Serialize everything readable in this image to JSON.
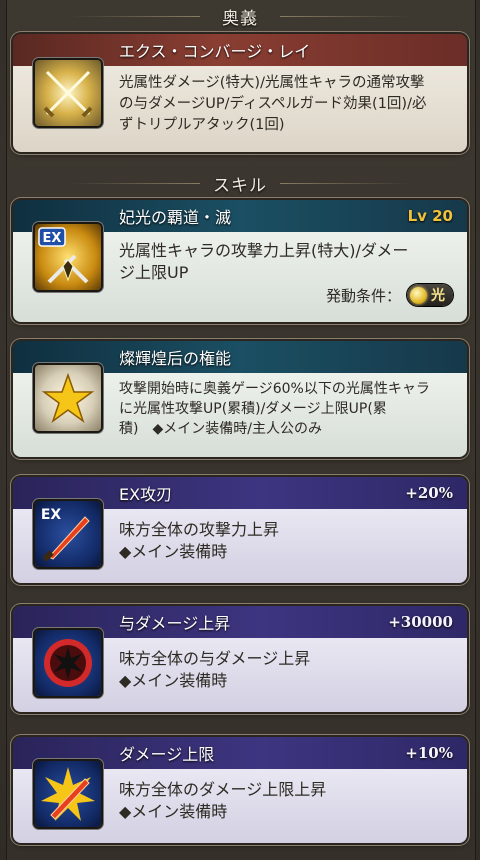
{
  "sections": {
    "ougi_title": "奥義",
    "skill_title": "スキル"
  },
  "ougi": {
    "name": "エクス・コンバージ・レイ",
    "desc_lines": [
      "光属性ダメージ(特大)/光属性キャラの通常攻撃",
      "の与ダメージUP/ディスペルガード効果(1回)/必",
      "ずトリプルアタック(1回)"
    ],
    "icon": "crossed-swords-icon"
  },
  "skills": [
    {
      "name": "妃光の覇道・滅",
      "level": "Lv 20",
      "desc_lines": [
        "光属性キャラの攻撃力上昇(特大)/ダメー",
        "ジ上限UP"
      ],
      "condition_label": "発動条件：",
      "condition_value": "光",
      "icon": "ex-swords-icon"
    },
    {
      "name": "燦輝煌后の権能",
      "desc_lines": [
        "攻撃開始時に奥義ゲージ60%以下の光属性キャラ",
        "に光属性攻撃UP(累積)/ダメージ上限UP(累",
        "積)　◆メイン装備時/主人公のみ"
      ],
      "icon": "star-icon"
    }
  ],
  "supports": [
    {
      "name": "EX攻刃",
      "value": "+20%",
      "desc_lines": [
        "味方全体の攻撃力上昇",
        "◆メイン装備時"
      ],
      "icon": "ex-blade-icon"
    },
    {
      "name": "与ダメージ上昇",
      "value": "+30000",
      "desc_lines": [
        "味方全体の与ダメージ上昇",
        "◆メイン装備時"
      ],
      "icon": "burst-icon"
    },
    {
      "name": "ダメージ上限",
      "value": "+10%",
      "desc_lines": [
        "味方全体のダメージ上限上昇",
        "◆メイン装備時"
      ],
      "icon": "blade-limit-icon"
    }
  ],
  "colors": {
    "ougi_header": "#8a3e32",
    "skill_header": "#1b4f63",
    "support_header": "#3d3580",
    "level_gold": "#f2c33a"
  }
}
